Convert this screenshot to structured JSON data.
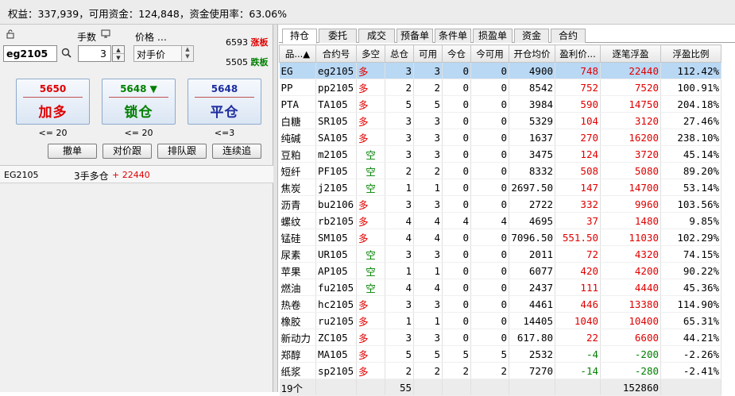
{
  "topbar": {
    "text": "权益：337,939，可用资金：124,848，资金使用率：63.06%"
  },
  "order": {
    "lock_icon": "lock-icon",
    "symbol": "eg2105",
    "qty_label": "手数",
    "qty_value": "3",
    "price_label": "价格 …",
    "price_value": "对手价",
    "upper_limit": "6593",
    "upper_limit_label": "涨板",
    "lower_limit": "5505",
    "lower_limit_label": "跌板",
    "buttons": [
      {
        "price": "5650",
        "label": "加多",
        "limit": "<= 20"
      },
      {
        "price": "5648",
        "label": "锁仓",
        "limit": "<= 20",
        "arrow": "▼"
      },
      {
        "price": "5648",
        "label": "平仓",
        "limit": "<=3"
      }
    ],
    "small_buttons": [
      "撤单",
      "对价跟",
      "排队跟",
      "连续追"
    ],
    "position_summary": {
      "symbol": "EG2105",
      "desc": "3手多仓",
      "pnl": "+ 22440"
    }
  },
  "tabs": [
    "持仓",
    "委托",
    "成交",
    "预备单",
    "条件单",
    "损盈单",
    "资金",
    "合约"
  ],
  "table": {
    "headers": [
      "品...▲",
      "合约号",
      "多空",
      "总仓",
      "可用",
      "今仓",
      "今可用",
      "开仓均价",
      "盈利价...",
      "逐笔浮盈",
      "浮盈比例"
    ],
    "rows": [
      [
        "EG",
        "eg2105",
        "多",
        "3",
        "3",
        "0",
        "0",
        "4900",
        "748",
        "22440",
        "112.42%"
      ],
      [
        "PP",
        "pp2105",
        "多",
        "2",
        "2",
        "0",
        "0",
        "8542",
        "752",
        "7520",
        "100.91%"
      ],
      [
        "PTA",
        "TA105",
        "多",
        "5",
        "5",
        "0",
        "0",
        "3984",
        "590",
        "14750",
        "204.18%"
      ],
      [
        "白糖",
        "SR105",
        "多",
        "3",
        "3",
        "0",
        "0",
        "5329",
        "104",
        "3120",
        "27.46%"
      ],
      [
        "纯碱",
        "SA105",
        "多",
        "3",
        "3",
        "0",
        "0",
        "1637",
        "270",
        "16200",
        "238.10%"
      ],
      [
        "豆粕",
        "m2105",
        "空",
        "3",
        "3",
        "0",
        "0",
        "3475",
        "124",
        "3720",
        "45.14%"
      ],
      [
        "短纤",
        "PF105",
        "空",
        "2",
        "2",
        "0",
        "0",
        "8332",
        "508",
        "5080",
        "89.20%"
      ],
      [
        "焦炭",
        "j2105",
        "空",
        "1",
        "1",
        "0",
        "0",
        "2697.50",
        "147",
        "14700",
        "53.14%"
      ],
      [
        "沥青",
        "bu2106",
        "多",
        "3",
        "3",
        "0",
        "0",
        "2722",
        "332",
        "9960",
        "103.56%"
      ],
      [
        "螺纹",
        "rb2105",
        "多",
        "4",
        "4",
        "4",
        "4",
        "4695",
        "37",
        "1480",
        "9.85%"
      ],
      [
        "锰硅",
        "SM105",
        "多",
        "4",
        "4",
        "0",
        "0",
        "7096.50",
        "551.50",
        "11030",
        "102.29%"
      ],
      [
        "尿素",
        "UR105",
        "空",
        "3",
        "3",
        "0",
        "0",
        "2011",
        "72",
        "4320",
        "74.15%"
      ],
      [
        "苹果",
        "AP105",
        "空",
        "1",
        "1",
        "0",
        "0",
        "6077",
        "420",
        "4200",
        "90.22%"
      ],
      [
        "燃油",
        "fu2105",
        "空",
        "4",
        "4",
        "0",
        "0",
        "2437",
        "111",
        "4440",
        "45.36%"
      ],
      [
        "热卷",
        "hc2105",
        "多",
        "3",
        "3",
        "0",
        "0",
        "4461",
        "446",
        "13380",
        "114.90%"
      ],
      [
        "橡胶",
        "ru2105",
        "多",
        "1",
        "1",
        "0",
        "0",
        "14405",
        "1040",
        "10400",
        "65.31%"
      ],
      [
        "新动力",
        "ZC105",
        "多",
        "3",
        "3",
        "0",
        "0",
        "617.80",
        "22",
        "6600",
        "44.21%"
      ],
      [
        "郑醇",
        "MA105",
        "多",
        "5",
        "5",
        "5",
        "5",
        "2532",
        "-4",
        "-200",
        "-2.26%"
      ],
      [
        "纸浆",
        "sp2105",
        "多",
        "2",
        "2",
        "2",
        "2",
        "7270",
        "-14",
        "-280",
        "-2.41%"
      ]
    ],
    "footer": {
      "count": "19个",
      "total_pos": "55",
      "total_pnl": "152860"
    }
  },
  "colors": {
    "long": "#e00000",
    "short": "#008000",
    "selected_row": "#b9d8f4"
  }
}
